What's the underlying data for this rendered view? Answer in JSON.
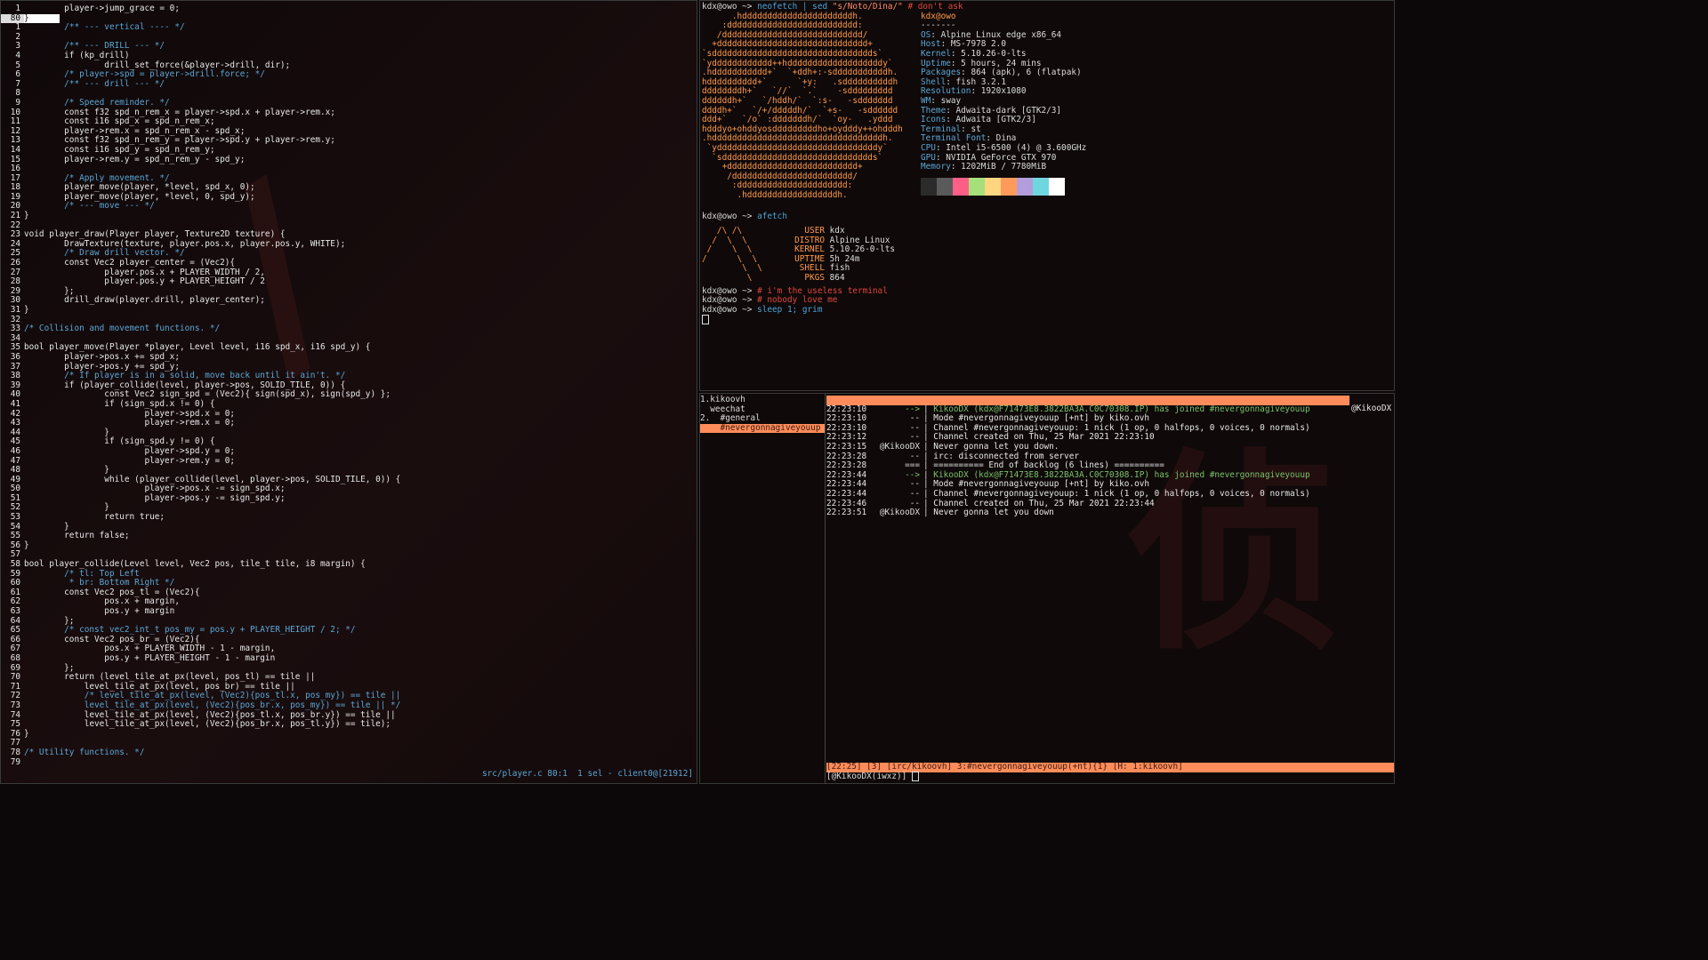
{
  "editor": {
    "lines": [
      {
        "n": "1",
        "t": "        player->jump_grace = 0;",
        "c": "code"
      },
      {
        "n": "80",
        "t": "}",
        "c": "code",
        "cur": true
      },
      {
        "n": "1",
        "t": "        /** --- vertical ---- */",
        "c": "cm"
      },
      {
        "n": "2",
        "t": "",
        "c": "code"
      },
      {
        "n": "3",
        "t": "        /** --- DRILL --- */",
        "c": "cm"
      },
      {
        "n": "4",
        "t": "        if (kp_drill)",
        "c": "code"
      },
      {
        "n": "5",
        "t": "                drill_set_force(&player->drill, dir);",
        "c": "code"
      },
      {
        "n": "6",
        "t": "        /* player->spd = player->drill.force; */",
        "c": "cm"
      },
      {
        "n": "7",
        "t": "        /** --- drill --- */",
        "c": "cm"
      },
      {
        "n": "8",
        "t": "",
        "c": "code"
      },
      {
        "n": "9",
        "t": "        /* Speed reminder. */",
        "c": "cm"
      },
      {
        "n": "10",
        "t": "        const f32 spd_n_rem_x = player->spd.x + player->rem.x;",
        "c": "code"
      },
      {
        "n": "11",
        "t": "        const i16 spd_x = spd_n_rem_x;",
        "c": "code"
      },
      {
        "n": "12",
        "t": "        player->rem.x = spd_n_rem_x - spd_x;",
        "c": "code"
      },
      {
        "n": "13",
        "t": "        const f32 spd_n_rem_y = player->spd.y + player->rem.y;",
        "c": "code"
      },
      {
        "n": "14",
        "t": "        const i16 spd_y = spd_n_rem_y;",
        "c": "code"
      },
      {
        "n": "15",
        "t": "        player->rem.y = spd_n_rem_y - spd_y;",
        "c": "code"
      },
      {
        "n": "16",
        "t": "",
        "c": "code"
      },
      {
        "n": "17",
        "t": "        /* Apply movement. */",
        "c": "cm"
      },
      {
        "n": "18",
        "t": "        player_move(player, *level, spd_x, 0);",
        "c": "code"
      },
      {
        "n": "19",
        "t": "        player_move(player, *level, 0, spd_y);",
        "c": "code"
      },
      {
        "n": "20",
        "t": "        /* --- move --- */",
        "c": "cm"
      },
      {
        "n": "21",
        "t": "}",
        "c": "code"
      },
      {
        "n": "22",
        "t": "",
        "c": "code"
      },
      {
        "n": "23",
        "t": "void player_draw(Player player, Texture2D texture) {",
        "c": "code"
      },
      {
        "n": "24",
        "t": "        DrawTexture(texture, player.pos.x, player.pos.y, WHITE);",
        "c": "code"
      },
      {
        "n": "25",
        "t": "        /* Draw drill vector. */",
        "c": "cm"
      },
      {
        "n": "26",
        "t": "        const Vec2 player_center = (Vec2){",
        "c": "code"
      },
      {
        "n": "27",
        "t": "                player.pos.x + PLAYER_WIDTH / 2,",
        "c": "code"
      },
      {
        "n": "28",
        "t": "                player.pos.y + PLAYER_HEIGHT / 2",
        "c": "code"
      },
      {
        "n": "29",
        "t": "        };",
        "c": "code"
      },
      {
        "n": "30",
        "t": "        drill_draw(player.drill, player_center);",
        "c": "code"
      },
      {
        "n": "31",
        "t": "}",
        "c": "code"
      },
      {
        "n": "32",
        "t": "",
        "c": "code"
      },
      {
        "n": "33",
        "t": "/* Collision and movement functions. */",
        "c": "cm"
      },
      {
        "n": "34",
        "t": "",
        "c": "code"
      },
      {
        "n": "35",
        "t": "bool player_move(Player *player, Level level, i16 spd_x, i16 spd_y) {",
        "c": "code"
      },
      {
        "n": "36",
        "t": "        player->pos.x += spd_x;",
        "c": "code"
      },
      {
        "n": "37",
        "t": "        player->pos.y += spd_y;",
        "c": "code"
      },
      {
        "n": "38",
        "t": "        /* If player is in a solid, move back until it ain't. */",
        "c": "cm"
      },
      {
        "n": "39",
        "t": "        if (player_collide(level, player->pos, SOLID_TILE, 0)) {",
        "c": "code"
      },
      {
        "n": "40",
        "t": "                const Vec2 sign_spd = (Vec2){ sign(spd_x), sign(spd_y) };",
        "c": "code"
      },
      {
        "n": "41",
        "t": "                if (sign_spd.x != 0) {",
        "c": "code"
      },
      {
        "n": "42",
        "t": "                        player->spd.x = 0;",
        "c": "code"
      },
      {
        "n": "43",
        "t": "                        player->rem.x = 0;",
        "c": "code"
      },
      {
        "n": "44",
        "t": "                }",
        "c": "code"
      },
      {
        "n": "45",
        "t": "                if (sign_spd.y != 0) {",
        "c": "code"
      },
      {
        "n": "46",
        "t": "                        player->spd.y = 0;",
        "c": "code"
      },
      {
        "n": "47",
        "t": "                        player->rem.y = 0;",
        "c": "code"
      },
      {
        "n": "48",
        "t": "                }",
        "c": "code"
      },
      {
        "n": "49",
        "t": "                while (player_collide(level, player->pos, SOLID_TILE, 0)) {",
        "c": "code"
      },
      {
        "n": "50",
        "t": "                        player->pos.x -= sign_spd.x;",
        "c": "code"
      },
      {
        "n": "51",
        "t": "                        player->pos.y -= sign_spd.y;",
        "c": "code"
      },
      {
        "n": "52",
        "t": "                }",
        "c": "code"
      },
      {
        "n": "53",
        "t": "                return true;",
        "c": "code"
      },
      {
        "n": "54",
        "t": "        }",
        "c": "code"
      },
      {
        "n": "55",
        "t": "        return false;",
        "c": "code"
      },
      {
        "n": "56",
        "t": "}",
        "c": "code"
      },
      {
        "n": "57",
        "t": "",
        "c": "code"
      },
      {
        "n": "58",
        "t": "bool player_collide(Level level, Vec2 pos, tile_t tile, i8 margin) {",
        "c": "code"
      },
      {
        "n": "59",
        "t": "        /* tl: Top Left",
        "c": "cm"
      },
      {
        "n": "60",
        "t": "         * br: Bottom Right */",
        "c": "cm"
      },
      {
        "n": "61",
        "t": "        const Vec2 pos_tl = (Vec2){",
        "c": "code"
      },
      {
        "n": "62",
        "t": "                pos.x + margin,",
        "c": "code"
      },
      {
        "n": "63",
        "t": "                pos.y + margin",
        "c": "code"
      },
      {
        "n": "64",
        "t": "        };",
        "c": "code"
      },
      {
        "n": "65",
        "t": "        /* const vec2_int_t pos_my = pos.y + PLAYER_HEIGHT / 2; */",
        "c": "cm"
      },
      {
        "n": "66",
        "t": "        const Vec2 pos_br = (Vec2){",
        "c": "code"
      },
      {
        "n": "67",
        "t": "                pos.x + PLAYER_WIDTH - 1 - margin,",
        "c": "code"
      },
      {
        "n": "68",
        "t": "                pos.y + PLAYER_HEIGHT - 1 - margin",
        "c": "code"
      },
      {
        "n": "69",
        "t": "        };",
        "c": "code"
      },
      {
        "n": "70",
        "t": "        return (level_tile_at_px(level, pos_tl) == tile ||",
        "c": "code"
      },
      {
        "n": "71",
        "t": "            level_tile_at_px(level, pos_br) == tile ||",
        "c": "code"
      },
      {
        "n": "72",
        "t": "            /* level_tile_at_px(level, (Vec2){pos_tl.x, pos_my}) == tile ||",
        "c": "cm"
      },
      {
        "n": "73",
        "t": "            level_tile_at_px(level, (Vec2){pos_br.x, pos_my}) == tile || */",
        "c": "cm"
      },
      {
        "n": "74",
        "t": "            level_tile_at_px(level, (Vec2){pos_tl.x, pos_br.y}) == tile ||",
        "c": "code"
      },
      {
        "n": "75",
        "t": "            level_tile_at_px(level, (Vec2){pos_br.x, pos_tl.y}) == tile);",
        "c": "code"
      },
      {
        "n": "76",
        "t": "}",
        "c": "code"
      },
      {
        "n": "77",
        "t": "",
        "c": "code"
      },
      {
        "n": "78",
        "t": "/* Utility functions. */",
        "c": "cm"
      },
      {
        "n": "79",
        "t": "",
        "c": "code"
      }
    ],
    "status": "src/player.c 80:1  1 sel - client0@[21912]"
  },
  "terminal": {
    "cmd1_prompt": "kdx@owo ~> ",
    "cmd1_a": "neofetch | sed ",
    "cmd1_str": "\"s/Noto/Dina/\"",
    "cmd1_cmt": " # don't ask",
    "ascii": [
      "      .hddddddddddddddddddddddh.",
      "    :dddddddddddddddddddddddddd:",
      "   /dddddddddddddddddddddddddddd/",
      "  +dddddddddddddddddddddddddddddd+",
      "`sdddddddddddddddddddddddddddddddds`",
      "`ydddddddddddd++hdddddddddddddddddddy`",
      ".hddddddddddd+`  `+ddh+:-sdddddddddddh.",
      "hdddddddddd+`      `+y:   .sddddddddddh",
      "ddddddddh+`   `//`  `.`    -sddddddddd",
      "ddddddh+`   `/hddh/`  `:s-   -sddddddd",
      "ddddh+`   `/+/dddddh/`  `+s-   -sdddddd",
      "ddd+`   `/o` :dddddddh/`  `oy-   .yddd",
      "hdddyo+ohddyosdddddddddho+oydddy++ohdddh",
      ".hddddddddddddddddddddddddddddddddddh.",
      " `yddddddddddddddddddddddddddddddddy`",
      "  `sdddddddddddddddddddddddddddddds`",
      "    +dddddddddddddddddddddddddd+",
      "     /dddddddddddddddddddddddd/",
      "      :dddddddddddddddddddddd:",
      "       .hddddddddddddddddddh."
    ],
    "userhost": "kdx@owo",
    "sepline": "-------",
    "info": [
      {
        "k": "OS",
        "v": "Alpine Linux edge x86_64"
      },
      {
        "k": "Host",
        "v": "MS-7978 2.0"
      },
      {
        "k": "Kernel",
        "v": "5.10.26-0-lts"
      },
      {
        "k": "Uptime",
        "v": "5 hours, 24 mins"
      },
      {
        "k": "Packages",
        "v": "864 (apk), 6 (flatpak)"
      },
      {
        "k": "Shell",
        "v": "fish 3.2.1"
      },
      {
        "k": "Resolution",
        "v": "1920x1080"
      },
      {
        "k": "WM",
        "v": "sway"
      },
      {
        "k": "Theme",
        "v": "Adwaita-dark [GTK2/3]"
      },
      {
        "k": "Icons",
        "v": "Adwaita [GTK2/3]"
      },
      {
        "k": "Terminal",
        "v": "st"
      },
      {
        "k": "Terminal Font",
        "v": "Dina"
      },
      {
        "k": "CPU",
        "v": "Intel i5-6500 (4) @ 3.600GHz"
      },
      {
        "k": "GPU",
        "v": "NVIDIA GeForce GTX 970"
      },
      {
        "k": "Memory",
        "v": "1202MiB / 7780MiB"
      }
    ],
    "swatches": [
      "#2b2b2b",
      "#5a5a5a",
      "#ff5f87",
      "#a6e07a",
      "#ffd580",
      "#ff9a5a",
      "#b39ddb",
      "#6fd6e0",
      "#ffffff"
    ],
    "cmd2_prompt": "kdx@owo ~> ",
    "cmd2": "afetch",
    "afetch_art": [
      "   /\\ /\\",
      "  /  \\  \\",
      " /    \\  \\",
      "/      \\  \\",
      "        \\  \\",
      "         \\"
    ],
    "afetch": [
      {
        "k": "USER",
        "v": "kdx"
      },
      {
        "k": "DISTRO",
        "v": "Alpine Linux"
      },
      {
        "k": "KERNEL",
        "v": "5.10.26-0-lts"
      },
      {
        "k": "UPTIME",
        "v": "5h 24m"
      },
      {
        "k": "SHELL",
        "v": "fish"
      },
      {
        "k": "PKGS",
        "v": "864"
      }
    ],
    "cmd3_prompt": "kdx@owo ~> ",
    "cmd3": "# i'm the useless terminal",
    "cmd4_prompt": "kdx@owo ~> ",
    "cmd4": "# nobody love me",
    "cmd5_prompt": "kdx@owo ~> ",
    "cmd5": "sleep 1; grim"
  },
  "irc": {
    "buffers": [
      {
        "label": "1.kikoovh",
        "sel": false
      },
      {
        "label": "  weechat",
        "sel": false
      },
      {
        "label": "2.  #general",
        "sel": false
      },
      {
        "label": "    #nevergonnagiveyouup",
        "sel": true
      }
    ],
    "nick": "@KikooDX",
    "lines": [
      {
        "ts": "22:23:10",
        "pfx": "-->",
        "cls": "join",
        "msg": "KikooDX (kdx@F71473E8.3822BA3A.C0C70308.IP) has joined #nevergonnagiveyouup"
      },
      {
        "ts": "22:23:10",
        "pfx": "--",
        "cls": "msg",
        "msg": "Mode #nevergonnagiveyouup [+nt] by kiko.ovh"
      },
      {
        "ts": "22:23:10",
        "pfx": "--",
        "cls": "msg",
        "msg": "Channel #nevergonnagiveyouup: 1 nick (1 op, 0 halfops, 0 voices, 0 normals)"
      },
      {
        "ts": "22:23:12",
        "pfx": "--",
        "cls": "msg",
        "msg": "Channel created on Thu, 25 Mar 2021 22:23:10"
      },
      {
        "ts": "22:23:15",
        "pfx": "@KikooDX",
        "cls": "msg",
        "msg": "Never gonna let you down."
      },
      {
        "ts": "22:23:28",
        "pfx": "--",
        "cls": "msg",
        "msg": "irc: disconnected from server"
      },
      {
        "ts": "22:23:28",
        "pfx": "===",
        "cls": "msg",
        "msg": "========== End of backlog (6 lines) =========="
      },
      {
        "ts": "22:23:44",
        "pfx": "-->",
        "cls": "join",
        "msg": "KikooDX (kdx@F71473E8.3822BA3A.C0C70308.IP) has joined #nevergonnagiveyouup"
      },
      {
        "ts": "22:23:44",
        "pfx": "--",
        "cls": "msg",
        "msg": "Mode #nevergonnagiveyouup [+nt] by kiko.ovh"
      },
      {
        "ts": "22:23:44",
        "pfx": "--",
        "cls": "msg",
        "msg": "Channel #nevergonnagiveyouup: 1 nick (1 op, 0 halfops, 0 voices, 0 normals)"
      },
      {
        "ts": "22:23:46",
        "pfx": "--",
        "cls": "msg",
        "msg": "Channel created on Thu, 25 Mar 2021 22:23:44"
      },
      {
        "ts": "22:23:51",
        "pfx": "@KikooDX",
        "cls": "msg",
        "msg": "Never gonna let you down"
      }
    ],
    "statusbar": "[22:25] [3] [irc/kikoovh] 3:#nevergonnagiveyouup(+nt){1} [H: 1:kikoovh]",
    "input": "[@KikooDX(iwxz)] "
  }
}
